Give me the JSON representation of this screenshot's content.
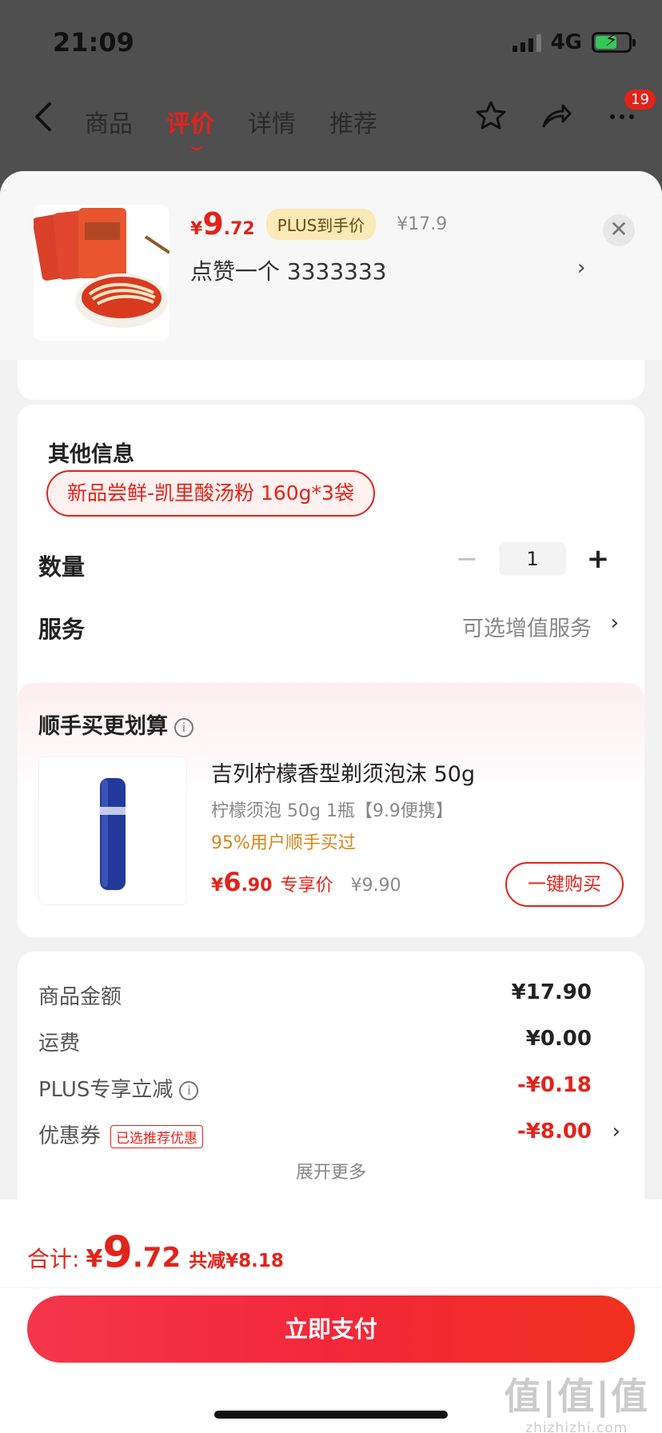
{
  "status_bar": {
    "time": "21:09",
    "network": "4G"
  },
  "nav": {
    "tabs": [
      "商品",
      "评价",
      "详情",
      "推荐"
    ],
    "active_tab": "评价",
    "badge_count": "19"
  },
  "product": {
    "price_symbol": "¥",
    "price_int": "9",
    "price_dec": ".72",
    "plus_tag": "PLUS到手价",
    "original_price": "¥17.9",
    "spec_summary": "点赞一个  3333333"
  },
  "options": {
    "other_info_title": "其他信息",
    "variant": "新品尝鲜-凯里酸汤粉 160g*3袋",
    "quantity_label": "数量",
    "quantity_value": "1",
    "service_label": "服务",
    "service_value": "可选增值服务"
  },
  "upsell": {
    "title": "顺手买更划算",
    "name": "吉列柠檬香型剃须泡沫 50g",
    "spec": "柠檬须泡 50g 1瓶【9.9便携】",
    "hint": "95%用户顺手买过",
    "price_symbol": "¥",
    "price_int": "6",
    "price_dec": ".90",
    "price_tag": "专享价",
    "original_price": "¥9.90",
    "buy_button": "一键购买"
  },
  "summary": {
    "rows": [
      {
        "label": "商品金额",
        "value": "¥17.90"
      },
      {
        "label": "运费",
        "value": "¥0.00"
      },
      {
        "label": "PLUS专享立减",
        "value": "-¥0.18"
      },
      {
        "label": "优惠券",
        "tag": "已选推荐优惠",
        "value": "-¥8.00"
      }
    ],
    "expand_more": "展开更多"
  },
  "footer": {
    "total_label": "合计:",
    "total_symbol": "¥",
    "total_int": "9",
    "total_dec": ".72",
    "saved": "共减¥8.18",
    "pay_button": "立即支付"
  },
  "watermark": {
    "big": "值|值|值",
    "small": "zhizhizhi.com"
  },
  "colors": {
    "accent": "#e2231a",
    "plus_gold": "#fbe9b7",
    "hint_orange": "#d5861b"
  }
}
